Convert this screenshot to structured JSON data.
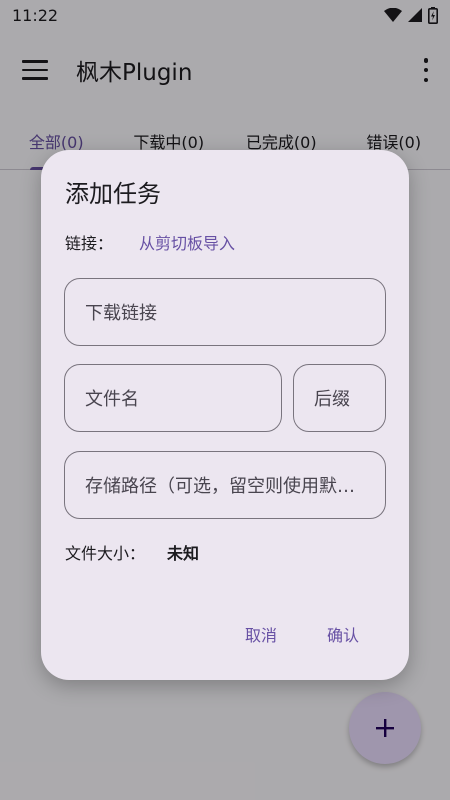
{
  "status_bar": {
    "time": "11:22"
  },
  "app_bar": {
    "title": "枫木Plugin",
    "menu_icon": "menu-icon",
    "more_icon": "more-vert-icon"
  },
  "tabs": [
    {
      "label": "全部(0)",
      "active": true
    },
    {
      "label": "下载中(0)",
      "active": false
    },
    {
      "label": "已完成(0)",
      "active": false
    },
    {
      "label": "错误(0)",
      "active": false
    }
  ],
  "fab": {
    "icon": "plus-icon"
  },
  "dialog": {
    "title": "添加任务",
    "link_label": "链接：",
    "paste_label": "从剪切板导入",
    "url_placeholder": "下载链接",
    "filename_placeholder": "文件名",
    "suffix_placeholder": "后缀",
    "path_placeholder": "存储路径（可选，留空则使用默认路径）",
    "size_label": "文件大小：",
    "size_value": "未知",
    "cancel_label": "取消",
    "confirm_label": "确认"
  },
  "colors": {
    "accent": "#6750a4",
    "dialog_bg": "#ece6f0",
    "outline": "#79747e",
    "fab_bg": "#eaddff"
  }
}
